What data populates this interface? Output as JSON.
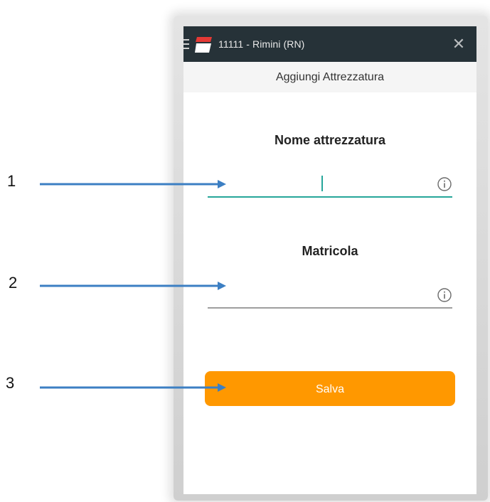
{
  "header": {
    "title": "11111 - Rimini (RN)",
    "close_symbol": "✕",
    "menu_icon": "hamburger-menu-icon",
    "logo_icon": "brand-logo-icon"
  },
  "subheader": {
    "title": "Aggiungi Attrezzatura"
  },
  "form": {
    "name_label": "Nome attrezzatura",
    "name_value": "",
    "serial_label": "Matricola",
    "serial_value": "",
    "save_label": "Salva"
  },
  "annotations": {
    "numbers": [
      "1",
      "2",
      "3"
    ],
    "arrow_color": "#3c7fc3"
  },
  "colors": {
    "topbar": "#263238",
    "accent_teal": "#26a69a",
    "button_orange": "#ff9800",
    "logo_red": "#e53935"
  }
}
